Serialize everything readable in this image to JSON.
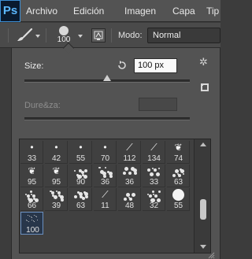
{
  "app": {
    "logo": "Ps"
  },
  "menu": [
    {
      "label": "Archivo"
    },
    {
      "label": "Edición"
    },
    {
      "label": "Imagen"
    },
    {
      "label": "Capa"
    },
    {
      "label": "Tip"
    }
  ],
  "options_bar": {
    "tool_icon": "brush-icon",
    "brush_size_value": "100",
    "toggle_panel_icon": "brush-panel-icon",
    "mode_label": "Modo:",
    "mode_value": "Normal"
  },
  "brush_picker": {
    "size_label": "Size:",
    "size_value": "100 px",
    "size_slider_fraction": 0.5,
    "hardness_label": "Dure&za:",
    "hardness_slider_fraction": 0,
    "reset_icon": "reset-icon",
    "gear_icon": "gear-icon",
    "new_preset_icon": "new-preset-icon",
    "presets": [
      {
        "num": "33",
        "kind": "dot"
      },
      {
        "num": "42",
        "kind": "dot"
      },
      {
        "num": "55",
        "kind": "dot"
      },
      {
        "num": "70",
        "kind": "dot"
      },
      {
        "num": "112",
        "kind": "stroke"
      },
      {
        "num": "134",
        "kind": "stroke"
      },
      {
        "num": "74",
        "kind": "leaf"
      },
      {
        "num": "95",
        "kind": "leaf"
      },
      {
        "num": "95",
        "kind": "leaf"
      },
      {
        "num": "90",
        "kind": "texture"
      },
      {
        "num": "36",
        "kind": "texture"
      },
      {
        "num": "36",
        "kind": "texture"
      },
      {
        "num": "33",
        "kind": "texture"
      },
      {
        "num": "63",
        "kind": "texture"
      },
      {
        "num": "66",
        "kind": "texture"
      },
      {
        "num": "39",
        "kind": "texture"
      },
      {
        "num": "63",
        "kind": "texture"
      },
      {
        "num": "11",
        "kind": "stroke"
      },
      {
        "num": "48",
        "kind": "texture"
      },
      {
        "num": "32",
        "kind": "texture"
      },
      {
        "num": "55",
        "kind": "round"
      },
      {
        "num": "100",
        "kind": "spray",
        "selected": true
      }
    ]
  },
  "colors": {
    "menubar": "#535353",
    "panel": "#535353",
    "selection": "#6a8fc0",
    "logo_text": "#5cb8ff"
  }
}
